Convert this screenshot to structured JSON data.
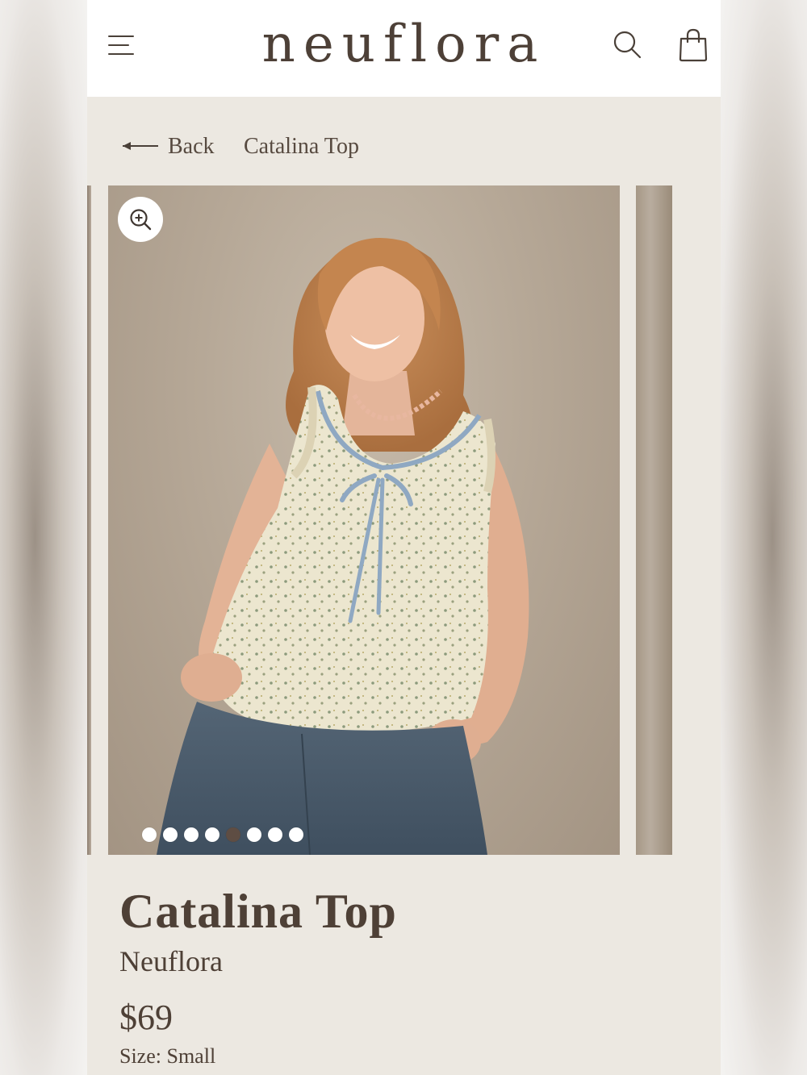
{
  "header": {
    "logo": "neuflora",
    "menu_icon": "hamburger-menu-icon",
    "search_icon": "search-icon",
    "bag_icon": "shopping-bag-icon"
  },
  "breadcrumb": {
    "back_label": "Back",
    "current": "Catalina Top"
  },
  "gallery": {
    "image_alt": "Woman smiling wearing a cream floral sleeveless top with blue ruffle trim and tie front, with denim jeans",
    "zoom_icon": "zoom-in-icon",
    "dot_count": 8,
    "active_dot": 5
  },
  "product": {
    "title": "Catalina Top",
    "brand": "Neuflora",
    "price": "$69",
    "size_label": "Size:",
    "size_value": "Small"
  },
  "colors": {
    "text": "#4e4036",
    "page_bg": "#ece8e1",
    "header_bg": "#ffffff",
    "active_dot": "#5e4d43"
  }
}
